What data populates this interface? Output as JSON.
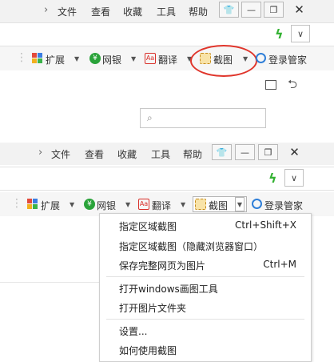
{
  "menubar": {
    "items": [
      "文件",
      "查看",
      "收藏",
      "工具",
      "帮助"
    ],
    "chevron": "›",
    "window_buttons": [
      "shirt-icon",
      "minimize-icon",
      "restore-icon",
      "close-icon"
    ]
  },
  "address": {
    "bolt_icon": "lightning-icon",
    "dropdown_icon": "chevron-down-icon"
  },
  "toolbar": {
    "extensions": "扩展",
    "netbank": "网银",
    "translate": "翻译",
    "screenshot": "截图",
    "login": "登录管家"
  },
  "context_menu": {
    "items": [
      {
        "label": "指定区域截图",
        "shortcut": "Ctrl+Shift+X"
      },
      {
        "label": "指定区域截图（隐藏浏览器窗口）",
        "shortcut": ""
      },
      {
        "label": "保存完整网页为图片",
        "shortcut": "Ctrl+M"
      },
      {
        "label": "打开windows画图工具",
        "shortcut": ""
      },
      {
        "label": "打开图片文件夹",
        "shortcut": ""
      },
      {
        "label": "设置...",
        "shortcut": ""
      },
      {
        "label": "如何使用截图",
        "shortcut": ""
      }
    ]
  },
  "colors": {
    "highlight": "#e0352b",
    "bolt": "#34b233",
    "netbank": "#2aa33a",
    "translate": "#d9302a"
  }
}
